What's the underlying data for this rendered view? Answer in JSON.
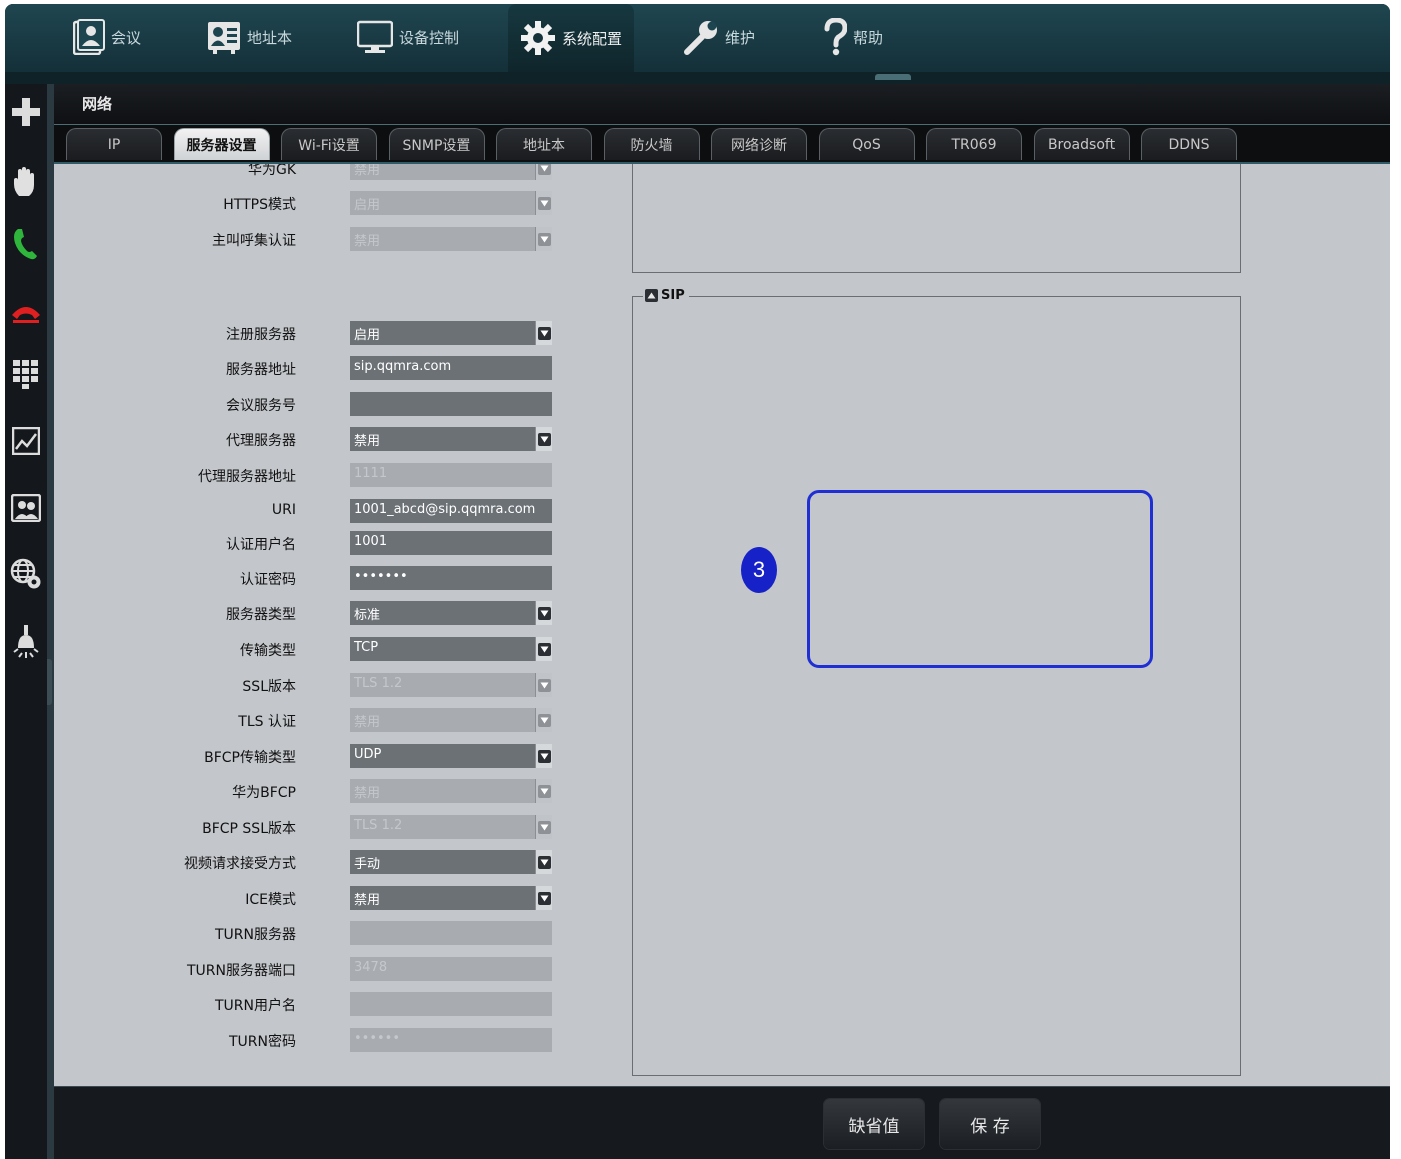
{
  "colors": {
    "accent_frame": "#1f2fd4",
    "badge": "#1622c8",
    "topbar": "#1f4650",
    "content_bg": "#c3c6cb"
  },
  "topnav": [
    {
      "label": "会议",
      "icon": "meeting-icon"
    },
    {
      "label": "地址本",
      "icon": "contacts-icon"
    },
    {
      "label": "设备控制",
      "icon": "monitor-icon"
    },
    {
      "label": "系统配置",
      "icon": "gear-icon",
      "active": true
    },
    {
      "label": "维护",
      "icon": "wrench-icon"
    },
    {
      "label": "帮助",
      "icon": "help-icon"
    }
  ],
  "sidebar_icons": [
    "plus-icon",
    "hand-icon",
    "phone-answer-icon",
    "phone-hangup-icon",
    "dialpad-icon",
    "chart-icon",
    "camera-icon",
    "globe-gear-icon",
    "lamp-icon"
  ],
  "section": {
    "title": "网络"
  },
  "tabs": [
    "IP",
    "服务器设置",
    "Wi-Fi设置",
    "SNMP设置",
    "地址本",
    "防火墙",
    "网络诊断",
    "QoS",
    "TR069",
    "Broadsoft",
    "DDNS"
  ],
  "active_tab": "服务器设置",
  "h323_tail": [
    {
      "label": "华为GK",
      "value": "禁用",
      "type": "select",
      "disabled": true
    },
    {
      "label": "HTTPS模式",
      "value": "启用",
      "type": "select",
      "disabled": true
    },
    {
      "label": "主叫呼集认证",
      "value": "禁用",
      "type": "select",
      "disabled": true
    }
  ],
  "sip": {
    "legend": "SIP",
    "fields": [
      {
        "label": "注册服务器",
        "value": "启用",
        "type": "select",
        "disabled": false
      },
      {
        "label": "服务器地址",
        "value": "sip.qqmra.com",
        "type": "input",
        "disabled": false
      },
      {
        "label": "会议服务号",
        "value": "",
        "type": "input",
        "disabled": false
      },
      {
        "label": "代理服务器",
        "value": "禁用",
        "type": "select",
        "disabled": false
      },
      {
        "label": "代理服务器地址",
        "value": "1111",
        "type": "input",
        "disabled": true
      },
      {
        "label": "URI",
        "value": "1001_abcd@sip.qqmra.com",
        "type": "input",
        "disabled": false
      },
      {
        "label": "认证用户名",
        "value": "1001",
        "type": "input",
        "disabled": false
      },
      {
        "label": "认证密码",
        "value": "•••••••",
        "type": "input",
        "disabled": false
      },
      {
        "label": "服务器类型",
        "value": "标准",
        "type": "select",
        "disabled": false
      },
      {
        "label": "传输类型",
        "value": "TCP",
        "type": "select",
        "disabled": false
      },
      {
        "label": "SSL版本",
        "value": "TLS 1.2",
        "type": "select",
        "disabled": true
      },
      {
        "label": "TLS 认证",
        "value": "禁用",
        "type": "select",
        "disabled": true
      },
      {
        "label": "BFCP传输类型",
        "value": "UDP",
        "type": "select",
        "disabled": false
      },
      {
        "label": "华为BFCP",
        "value": "禁用",
        "type": "select",
        "disabled": true
      },
      {
        "label": "BFCP SSL版本",
        "value": "TLS 1.2",
        "type": "select",
        "disabled": true
      },
      {
        "label": "视频请求接受方式",
        "value": "手动",
        "type": "select",
        "disabled": false
      },
      {
        "label": "ICE模式",
        "value": "禁用",
        "type": "select",
        "disabled": false
      },
      {
        "label": "TURN服务器",
        "value": "",
        "type": "input",
        "disabled": true
      },
      {
        "label": "TURN服务器端口",
        "value": "3478",
        "type": "input",
        "disabled": true
      },
      {
        "label": "TURN用户名",
        "value": "",
        "type": "input",
        "disabled": true
      },
      {
        "label": "TURN密码",
        "value": "••••••",
        "type": "input",
        "disabled": true
      }
    ]
  },
  "annotation": {
    "step": "3"
  },
  "footer": {
    "default_label": "缺省值",
    "save_label": "保 存"
  }
}
